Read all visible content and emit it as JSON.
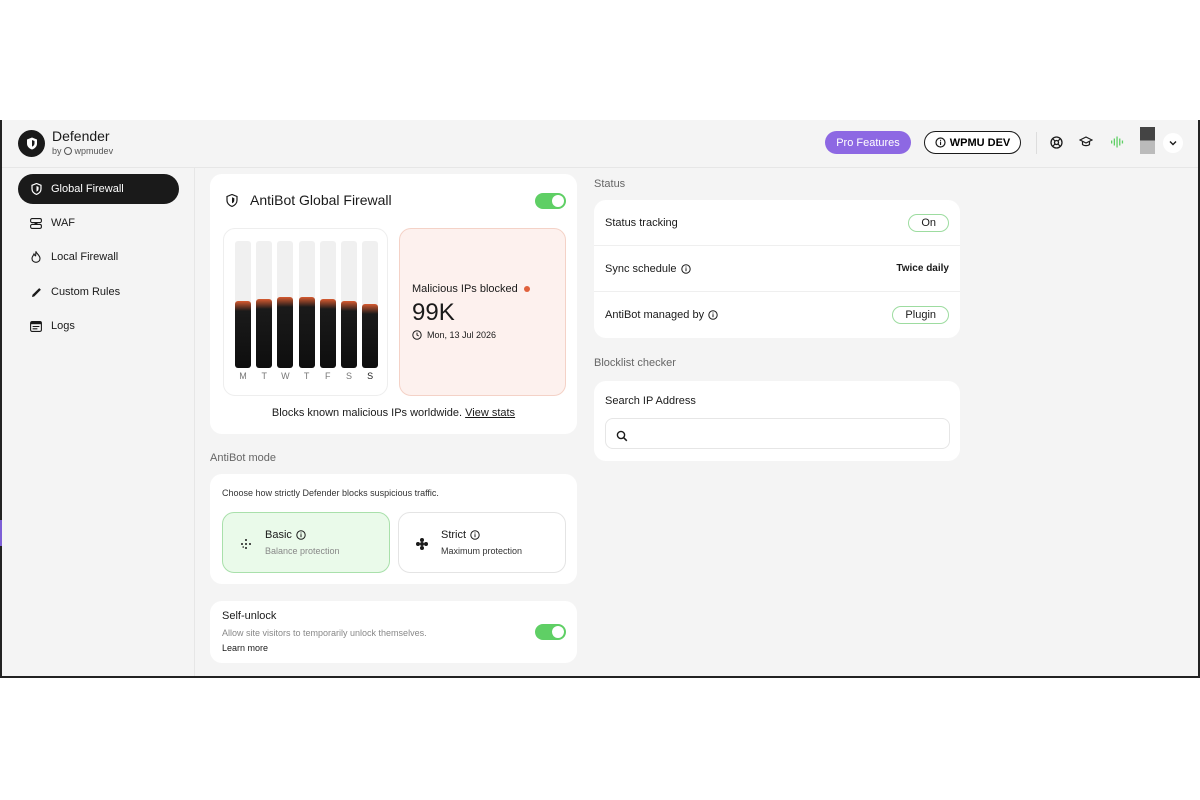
{
  "app": {
    "title": "Defender",
    "by_label": "by",
    "by_brand": "wpmudev"
  },
  "header": {
    "pro_label": "Pro Features",
    "wpmu_label": "WPMU DEV",
    "icons": [
      "help-globe-icon",
      "academy-icon",
      "voice-icon"
    ],
    "accent": "#8d68e3"
  },
  "sidebar": {
    "items": [
      {
        "label": "Global Firewall",
        "icon": "shield-icon",
        "active": true
      },
      {
        "label": "WAF",
        "icon": "waf-icon",
        "active": false
      },
      {
        "label": "Local Firewall",
        "icon": "fire-icon",
        "active": false
      },
      {
        "label": "Custom Rules",
        "icon": "pencil-icon",
        "active": false
      },
      {
        "label": "Logs",
        "icon": "logs-icon",
        "active": false
      }
    ]
  },
  "firewall": {
    "title": "AntiBot Global Firewall",
    "enabled": true,
    "chart_data": {
      "type": "bar",
      "categories": [
        "M",
        "T",
        "W",
        "T",
        "F",
        "S",
        "S"
      ],
      "values": [
        0.53,
        0.54,
        0.56,
        0.56,
        0.54,
        0.53,
        0.5
      ]
    },
    "malicious_label": "Malicious IPs blocked",
    "malicious_value": "99K",
    "malicious_date": "Mon, 13 Jul 2026",
    "description": "Blocks known malicious IPs worldwide.",
    "view_stats": "View stats",
    "toggle_color": "#5fcf65"
  },
  "antibot_mode": {
    "section_label": "AntiBot mode",
    "description": "Choose how strictly Defender blocks suspicious traffic.",
    "options": [
      {
        "title": "Basic",
        "subtitle": "Balance protection",
        "selected": true
      },
      {
        "title": "Strict",
        "subtitle": "Maximum protection",
        "selected": false
      }
    ]
  },
  "self_unlock": {
    "title": "Self-unlock",
    "description": "Allow site visitors to temporarily unlock themselves.",
    "link": "Learn more",
    "enabled": true
  },
  "status": {
    "section_label": "Status",
    "rows": [
      {
        "label": "Status tracking",
        "value": "On"
      },
      {
        "label": "Sync schedule",
        "value": "Twice daily"
      },
      {
        "label": "AntiBot managed by",
        "value": "Plugin"
      }
    ]
  },
  "blocklist": {
    "section_label": "Blocklist checker",
    "search_label": "Search IP Address",
    "search_value": ""
  }
}
